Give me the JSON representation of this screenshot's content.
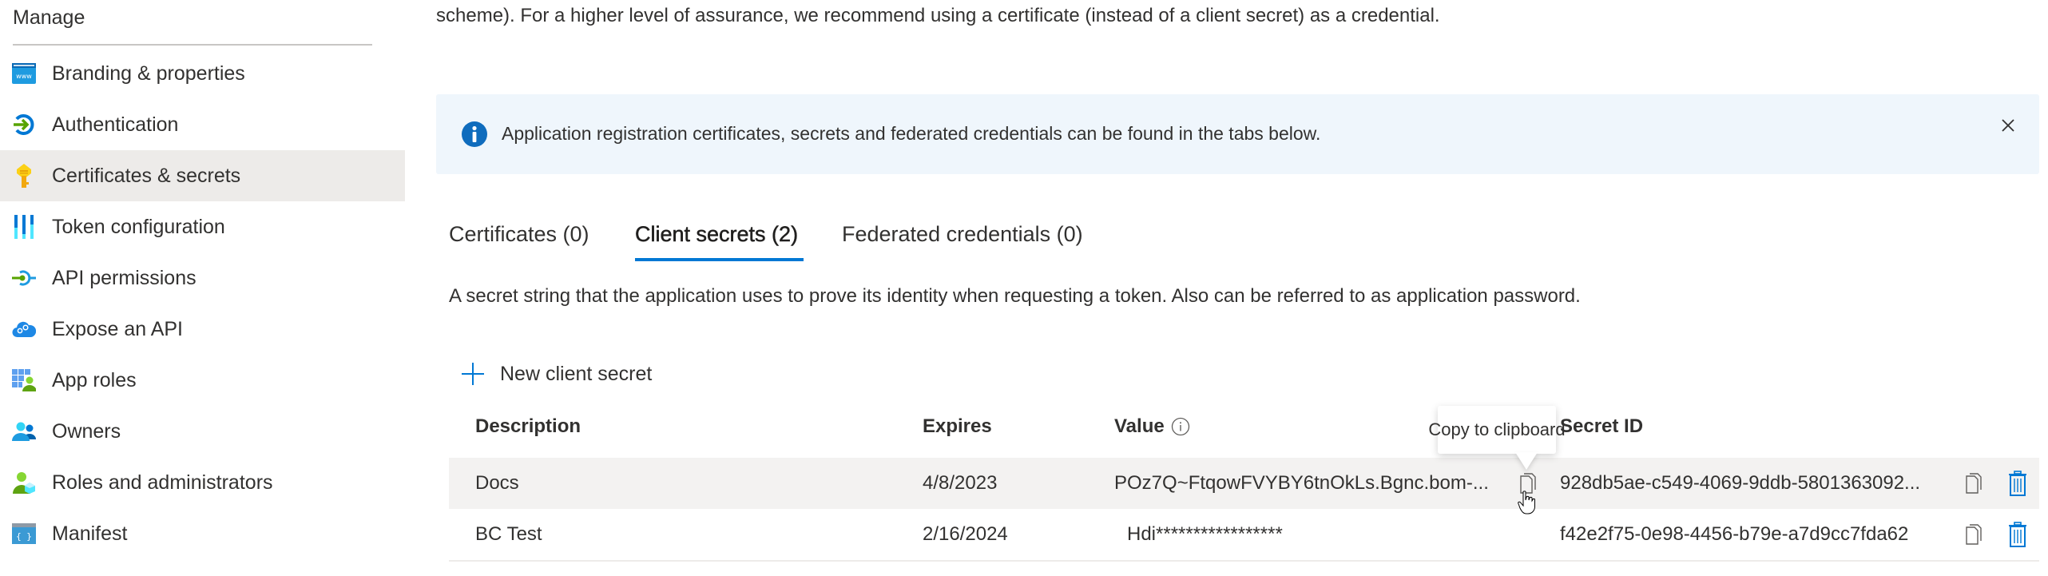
{
  "sidebar": {
    "section_title": "Manage",
    "items": [
      {
        "label": "Branding & properties",
        "icon": "branding-icon",
        "selected": false
      },
      {
        "label": "Authentication",
        "icon": "authentication-icon",
        "selected": false
      },
      {
        "label": "Certificates & secrets",
        "icon": "key-icon",
        "selected": true
      },
      {
        "label": "Token configuration",
        "icon": "token-configuration-icon",
        "selected": false
      },
      {
        "label": "API permissions",
        "icon": "api-permissions-icon",
        "selected": false
      },
      {
        "label": "Expose an API",
        "icon": "cloud-gear-icon",
        "selected": false
      },
      {
        "label": "App roles",
        "icon": "app-roles-icon",
        "selected": false
      },
      {
        "label": "Owners",
        "icon": "owners-icon",
        "selected": false
      },
      {
        "label": "Roles and administrators",
        "icon": "roles-admin-icon",
        "selected": false
      },
      {
        "label": "Manifest",
        "icon": "manifest-icon",
        "selected": false
      }
    ]
  },
  "main": {
    "intro_text": "scheme). For a higher level of assurance, we recommend using a certificate (instead of a client secret) as a credential.",
    "banner": {
      "text": "Application registration certificates, secrets and federated credentials can be found in the tabs below.",
      "close_label": "Close"
    },
    "tabs": [
      {
        "label": "Certificates (0)",
        "active": false
      },
      {
        "label": "Client secrets (2)",
        "active": true
      },
      {
        "label": "Federated credentials (0)",
        "active": false
      }
    ],
    "tab_description": "A secret string that the application uses to prove its identity when requesting a token. Also can be referred to as application password.",
    "new_secret_label": "New client secret",
    "table": {
      "headers": {
        "description": "Description",
        "expires": "Expires",
        "value": "Value",
        "secret_id": "Secret ID"
      },
      "rows": [
        {
          "description": "Docs",
          "expires": "4/8/2023",
          "value": "POz7Q~FtqowFVYBY6tnOkLs.Bgnc.bom-...",
          "secret_id": "928db5ae-c549-4069-9ddb-5801363092..."
        },
        {
          "description": "BC Test",
          "expires": "2/16/2024",
          "value": "Hdi*****************",
          "secret_id": "f42e2f75-0e98-4456-b79e-a7d9cc7fda62"
        }
      ]
    },
    "tooltip": "Copy to clipboard"
  },
  "colors": {
    "accent": "#0078d4",
    "banner_bg": "#eff6fc",
    "selected_bg": "#edebe9",
    "row_hover_bg": "#f3f2f1",
    "text": "#323130"
  }
}
